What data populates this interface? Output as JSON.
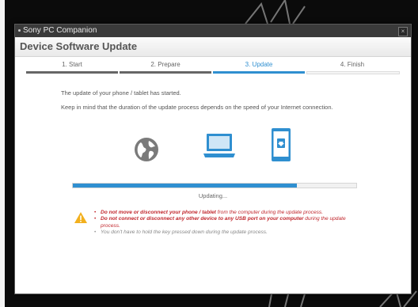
{
  "window": {
    "title": "Sony PC Companion",
    "close_glyph": "×",
    "header": "Device Software Update"
  },
  "steps": [
    {
      "label": "1. Start",
      "state": "done"
    },
    {
      "label": "2. Prepare",
      "state": "done"
    },
    {
      "label": "3. Update",
      "state": "active"
    },
    {
      "label": "4. Finish",
      "state": "pending"
    }
  ],
  "content": {
    "line1": "The update of your phone / tablet has started.",
    "line2": "Keep in mind that the duration of the update process depends on the speed of your Internet connection.",
    "icons": [
      "globe-icon",
      "laptop-icon",
      "phone-download-icon"
    ]
  },
  "progress": {
    "fraction": 0.79,
    "label": "Updating..."
  },
  "warnings": {
    "items": [
      {
        "bold": "Do not move or disconnect your phone / tablet",
        "text": " from the computer during the update process.",
        "style": "red"
      },
      {
        "bold": "Do not connect or disconnect any other device to any USB port on your computer",
        "text": " during the update process.",
        "style": "red"
      },
      {
        "bold": "",
        "text": "You don't have to hold the key pressed down during the update process.",
        "style": "gray"
      }
    ]
  },
  "colors": {
    "accent": "#2f8fd0",
    "warning_red": "#c1272d",
    "warning_yellow": "#f2b01e"
  }
}
